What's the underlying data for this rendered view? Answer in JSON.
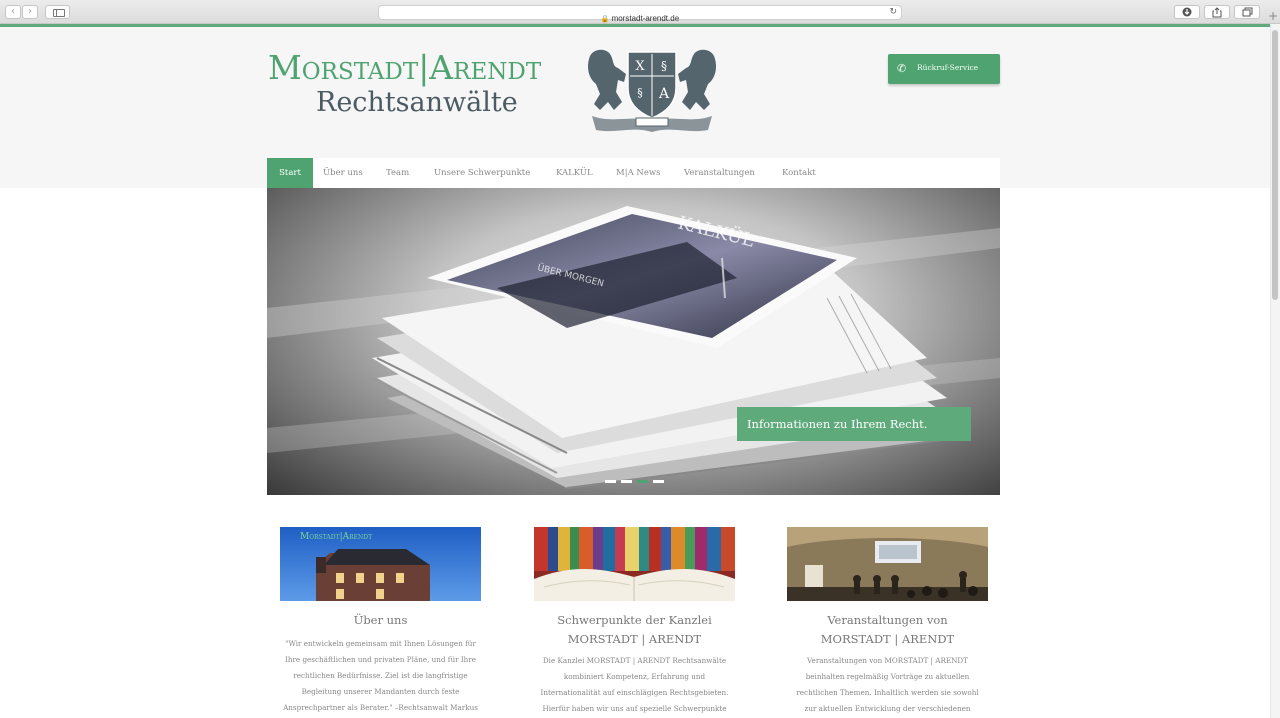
{
  "browser": {
    "url": "morstadt-arendt.de",
    "back_glyph": "‹",
    "forward_glyph": "›",
    "lock_glyph": "🔒",
    "reload_glyph": "↻",
    "new_tab_glyph": "+"
  },
  "header": {
    "logo_name": "Morstadt|Arendt",
    "logo_sub": "Rechtsanwälte",
    "crest_letters": [
      "X",
      "§",
      "§",
      "A"
    ],
    "callback_label": "Rückruf-Service",
    "callback_icon": "phone-icon"
  },
  "nav": {
    "items": [
      {
        "label": "Start",
        "active": true
      },
      {
        "label": "Über uns"
      },
      {
        "label": "Team"
      },
      {
        "label": "Unsere Schwerpunkte"
      },
      {
        "label": "KALKÜL"
      },
      {
        "label": "M|A News"
      },
      {
        "label": "Veranstaltungen"
      },
      {
        "label": "Kontakt"
      }
    ]
  },
  "hero": {
    "magazine_title": "KALKÜL",
    "magazine_headline": "ÜBER MORGEN",
    "caption": "Informationen zu Ihrem Recht.",
    "slide_count": 4,
    "active_slide": 3
  },
  "cards": [
    {
      "image_caption": "Morstadt|Arendt",
      "title_line1": "Über uns",
      "title_line2": "",
      "text": [
        "\"Wir entwickeln gemeinsam mit Ihnen Lösungen für",
        "Ihre geschäftlichen und privaten Pläne, und für Ihre",
        "rechtlichen Bedürfnisse. Ziel ist die langfristige",
        "Begleitung unserer Mandanten durch feste",
        "Ansprechpartner als Berater.\" –Rechtsanwalt Markus"
      ]
    },
    {
      "title_line1": "Schwerpunkte der Kanzlei",
      "title_line2": "MORSTADT | ARENDT",
      "text": [
        "Die Kanzlei MORSTADT | ARENDT Rechtsanwälte",
        "kombiniert Kompetenz, Erfahrung und",
        "Internationalität auf einschlägigen Rechtsgebieten.",
        "Hierfür haben wir uns auf spezielle Schwerpunkte"
      ]
    },
    {
      "title_line1": "Veranstaltungen von",
      "title_line2": "MORSTADT | ARENDT",
      "text": [
        "Veranstaltungen von MORSTADT | ARENDT",
        "beinhalten regelmäßig Vorträge zu aktuellen",
        "rechtlichen Themen. Inhaltlich werden sie sowohl",
        "zur aktuellen Entwicklung der verschiedenen"
      ]
    }
  ],
  "colors": {
    "brand_green": "#4fa371",
    "logo_slate": "#4b5a63",
    "header_band": "#f6f6f6"
  }
}
